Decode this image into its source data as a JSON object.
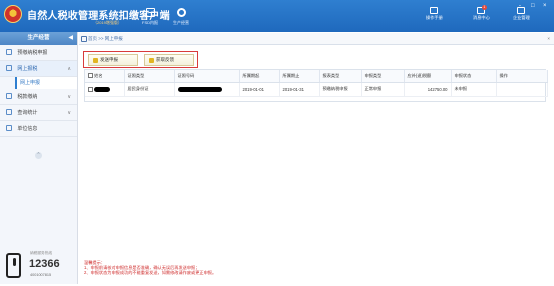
{
  "app": {
    "title": "自然人税收管理系统扣缴客户端",
    "version": "（2019增强版）",
    "top_buttons": [
      {
        "label": "FSD内报",
        "icon": "document-icon"
      },
      {
        "label": "生产经营",
        "icon": "gear-icon"
      }
    ],
    "right_tools": [
      {
        "label": "操作手册",
        "icon": "book-icon"
      },
      {
        "label": "消息中心",
        "icon": "message-icon",
        "count": "1"
      },
      {
        "label": "企业管理",
        "icon": "company-icon"
      }
    ],
    "window_controls": [
      "-",
      "□",
      "×"
    ]
  },
  "sidebar": {
    "title": "生产经营",
    "items": [
      {
        "label": "预缴纳税申报",
        "icon": "form-icon",
        "active": false
      },
      {
        "label": "网上报税",
        "icon": "send-icon",
        "active": true,
        "arrow": "∧"
      },
      {
        "label": "网上申报",
        "sub": true
      },
      {
        "label": "税款缴纳",
        "icon": "payment-icon",
        "active": false,
        "arrow": "∨"
      },
      {
        "label": "查询统计",
        "icon": "search-icon",
        "active": false,
        "arrow": "∨"
      },
      {
        "label": "单位信息",
        "icon": "building-icon",
        "active": false
      }
    ],
    "collapse_label": "◀",
    "hotline": {
      "label": "纳税服务热线",
      "number": "12366",
      "sub": "4001007815"
    }
  },
  "breadcrumb": {
    "home": "首页",
    "separator": " >> ",
    "current": "网上申报",
    "close": "×"
  },
  "toolbar": {
    "send_label": "发送申报",
    "fetch_label": "获取反馈"
  },
  "table": {
    "headers": [
      "姓名",
      "证照类型",
      "证照号码",
      "所属期起",
      "所属期止",
      "报表类型",
      "申报类型",
      "应补(退)税额",
      "申报状态",
      "操作"
    ],
    "rows": [
      {
        "name": "",
        "id_type": "居民身份证",
        "id_number": "",
        "period_start": "2019-01-01",
        "period_end": "2019-01-31",
        "report_type": "预缴纳税申报",
        "declare_type": "正常申报",
        "amount": "142750.00",
        "status": "未申报",
        "action": ""
      }
    ]
  },
  "notes": {
    "title": "温馨提示：",
    "lines": [
      "1、申报前请核对申报信息是否准确，确认无误后再发送申报；",
      "2、申报状态为申报成功的不能重复发送，如需修改请作废或更正申报。"
    ]
  },
  "colors": {
    "header_blue": "#1f69bd",
    "accent_red": "#d83b3b",
    "link_blue": "#2f7fd0"
  }
}
